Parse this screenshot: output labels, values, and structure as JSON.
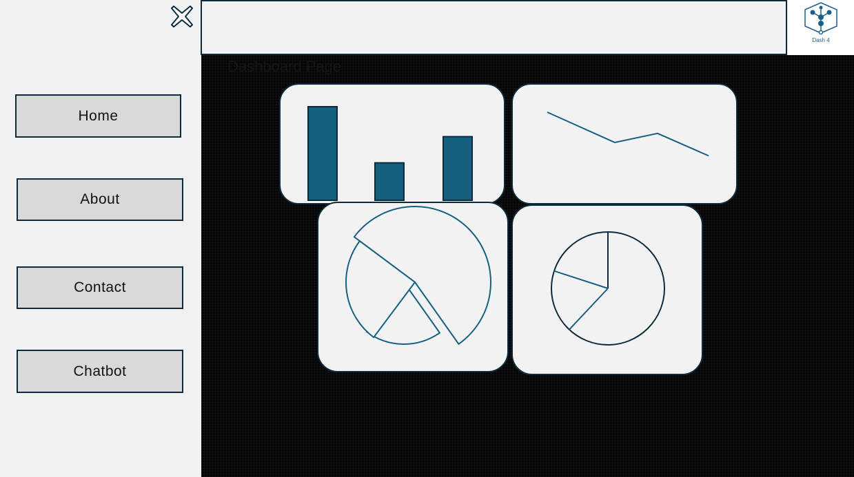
{
  "sidebar": {
    "close_icon": "close-x-icon",
    "items": [
      {
        "label": "Home"
      },
      {
        "label": "About"
      },
      {
        "label": "Contact"
      },
      {
        "label": "Chatbot"
      }
    ]
  },
  "header": {
    "logo_label": "Dash 4",
    "logo_icon": "network-graph-icon"
  },
  "main": {
    "heading": "Dashboard Page"
  },
  "colors": {
    "accent": "#15607f",
    "border": "#0d2a3d",
    "panel": "#f2f2f2",
    "background": "#050505"
  },
  "chart_data": [
    {
      "type": "bar",
      "values": [
        100,
        40,
        68
      ]
    },
    {
      "type": "line",
      "values": [
        100,
        50,
        65,
        28
      ]
    },
    {
      "type": "pie",
      "slices": [
        55,
        20,
        25
      ]
    },
    {
      "type": "pie",
      "slices": [
        62,
        18,
        20
      ]
    }
  ]
}
